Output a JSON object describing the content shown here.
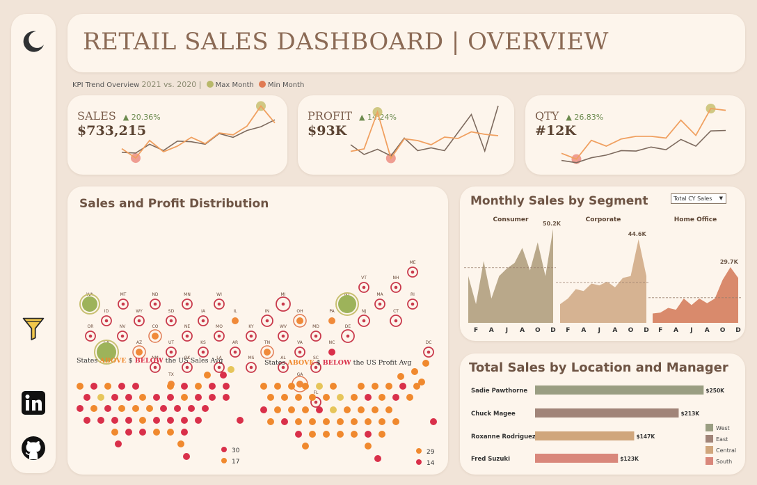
{
  "header": {
    "title": "RETAIL SALES DASHBOARD | OVERVIEW"
  },
  "sidebar": {
    "icons": [
      "moon-icon",
      "filter-icon",
      "linkedin-icon",
      "github-icon"
    ]
  },
  "kpi_legend": {
    "label": "KPI Trend Overview",
    "years": "2021 vs. 2020 |",
    "max_label": "Max Month",
    "min_label": "Min Month",
    "max_color": "#b8b86a",
    "min_color": "#e07a52"
  },
  "colors": {
    "current_line": "#f0a060",
    "previous_line": "#7d6a5e",
    "max_marker": "#c8c071",
    "min_marker": "#ec8d83"
  },
  "kpis": [
    {
      "label": "SALES",
      "delta": "▲ 20.36%",
      "value": "$733,215"
    },
    {
      "label": "PROFIT",
      "delta": "▲ 14.24%",
      "value": "$93K"
    },
    {
      "label": "QTY",
      "delta": "▲ 26.83%",
      "value": "#12K"
    }
  ],
  "map": {
    "title": "Sales and Profit Distribution",
    "sales_avg_prefix": "States",
    "sales_avg_above": "ABOVE",
    "sales_avg_mid": "$",
    "sales_avg_below": "BELOW",
    "sales_avg_suffix": "the US Sales Avg",
    "profit_avg_suffix": "the US Profit Avg",
    "sales_counts": {
      "below": "30",
      "above": "17"
    },
    "profit_counts": {
      "above": "29",
      "below": "14"
    },
    "above_color": "#f0892e",
    "below_color": "#d9304a",
    "states": [
      "WA",
      "MT",
      "ND",
      "MN",
      "WI",
      "MI",
      "NY",
      "VT",
      "NH",
      "ME",
      "ID",
      "WY",
      "SD",
      "IA",
      "IL",
      "IN",
      "OH",
      "PA",
      "NJ",
      "CT",
      "MA",
      "RI",
      "OR",
      "NV",
      "CO",
      "NE",
      "MO",
      "KY",
      "WV",
      "MD",
      "DE",
      "CA",
      "AZ",
      "UT",
      "KS",
      "AR",
      "TN",
      "VA",
      "NC",
      "DC",
      "NM",
      "OK",
      "LA",
      "MS",
      "AL",
      "SC",
      "TX",
      "GA",
      "FL"
    ]
  },
  "segments": {
    "title": "Monthly Sales by Segment",
    "dropdown": "Total CY Sales",
    "panels": [
      {
        "name": "Consumer",
        "max_label": "50.2K",
        "color": "#b9a88a"
      },
      {
        "name": "Corporate",
        "max_label": "44.6K",
        "color": "#d6b392"
      },
      {
        "name": "Home Office",
        "max_label": "29.7K",
        "color": "#d98a6c"
      }
    ],
    "month_ticks": [
      "F",
      "A",
      "J",
      "A",
      "O",
      "D"
    ]
  },
  "location": {
    "title": "Total Sales by Location and Manager",
    "legend": [
      {
        "name": "West",
        "color": "#9a9e82"
      },
      {
        "name": "East",
        "color": "#a18478"
      },
      {
        "name": "Central",
        "color": "#d0a67c"
      },
      {
        "name": "South",
        "color": "#d9877b"
      }
    ]
  },
  "chart_data": [
    {
      "type": "line",
      "title": "SALES",
      "x": [
        "Jan",
        "Feb",
        "Mar",
        "Apr",
        "May",
        "Jun",
        "Jul",
        "Aug",
        "Sep",
        "Oct",
        "Nov",
        "Dec"
      ],
      "series": [
        {
          "values": [
            46,
            31,
            59,
            41,
            50,
            64,
            54,
            71,
            68,
            82,
            114,
            87
          ]
        },
        {
          "values": [
            40,
            39,
            53,
            43,
            58,
            57,
            53,
            70,
            64,
            75,
            81,
            92
          ]
        }
      ],
      "ylim": [
        20,
        120
      ]
    },
    {
      "type": "line",
      "title": "PROFIT",
      "x": [
        "Jan",
        "Feb",
        "Mar",
        "Apr",
        "May",
        "Jun",
        "Jul",
        "Aug",
        "Sep",
        "Oct",
        "Nov",
        "Dec"
      ],
      "series": [
        {
          "values": [
            3.9,
            4.6,
            15.2,
            1.9,
            7.5,
            7.0,
            5.8,
            8.0,
            7.6,
            9.5,
            8.8,
            8.4
          ]
        },
        {
          "values": [
            5.8,
            3.0,
            4.5,
            2.6,
            7.7,
            4.1,
            4.9,
            4.1,
            9.3,
            14.5,
            4.0,
            17.0
          ]
        }
      ],
      "ylim": [
        0,
        18
      ]
    },
    {
      "type": "line",
      "title": "QTY",
      "x": [
        "Jan",
        "Feb",
        "Mar",
        "Apr",
        "May",
        "Jun",
        "Jul",
        "Aug",
        "Sep",
        "Oct",
        "Nov",
        "Dec"
      ],
      "series": [
        {
          "values": [
            560,
            430,
            850,
            720,
            880,
            940,
            940,
            900,
            1300,
            960,
            1560,
            1520
          ]
        },
        {
          "values": [
            400,
            350,
            460,
            520,
            620,
            610,
            700,
            640,
            870,
            720,
            1060,
            1070
          ]
        }
      ],
      "ylim": [
        300,
        1700
      ]
    },
    {
      "type": "bar",
      "title": "Total Sales by Location and Manager",
      "categories": [
        "Sadie Pawthorne",
        "Chuck Magee",
        "Roxanne Rodriguez",
        "Fred Suzuki"
      ],
      "series": [
        {
          "values": [
            250,
            213,
            147,
            123
          ]
        }
      ],
      "data_labels": [
        "$250K",
        "$213K",
        "$147K",
        "$123K"
      ],
      "xlim": [
        0,
        260
      ],
      "legend": "right"
    },
    {
      "type": "area",
      "title": "Monthly Sales by Segment",
      "x": [
        "Jan",
        "Feb",
        "Mar",
        "Apr",
        "May",
        "Jun",
        "Jul",
        "Aug",
        "Sep",
        "Oct",
        "Nov",
        "Dec"
      ],
      "series": [
        {
          "name": "Consumer",
          "values": [
            25,
            10,
            33,
            13,
            25,
            29,
            32,
            40,
            28,
            43,
            25,
            50.2
          ]
        },
        {
          "name": "Corporate",
          "values": [
            10,
            13,
            18,
            17,
            21,
            20,
            22,
            19,
            24,
            25,
            44.6,
            25
          ]
        },
        {
          "name": "Home Office",
          "values": [
            5,
            5.5,
            8,
            7,
            13,
            9.5,
            13,
            10.5,
            13,
            23,
            29.7,
            24
          ]
        }
      ],
      "x_ticks": [
        "F",
        "A",
        "J",
        "A",
        "O",
        "D"
      ],
      "ylim": [
        0,
        52
      ]
    }
  ]
}
